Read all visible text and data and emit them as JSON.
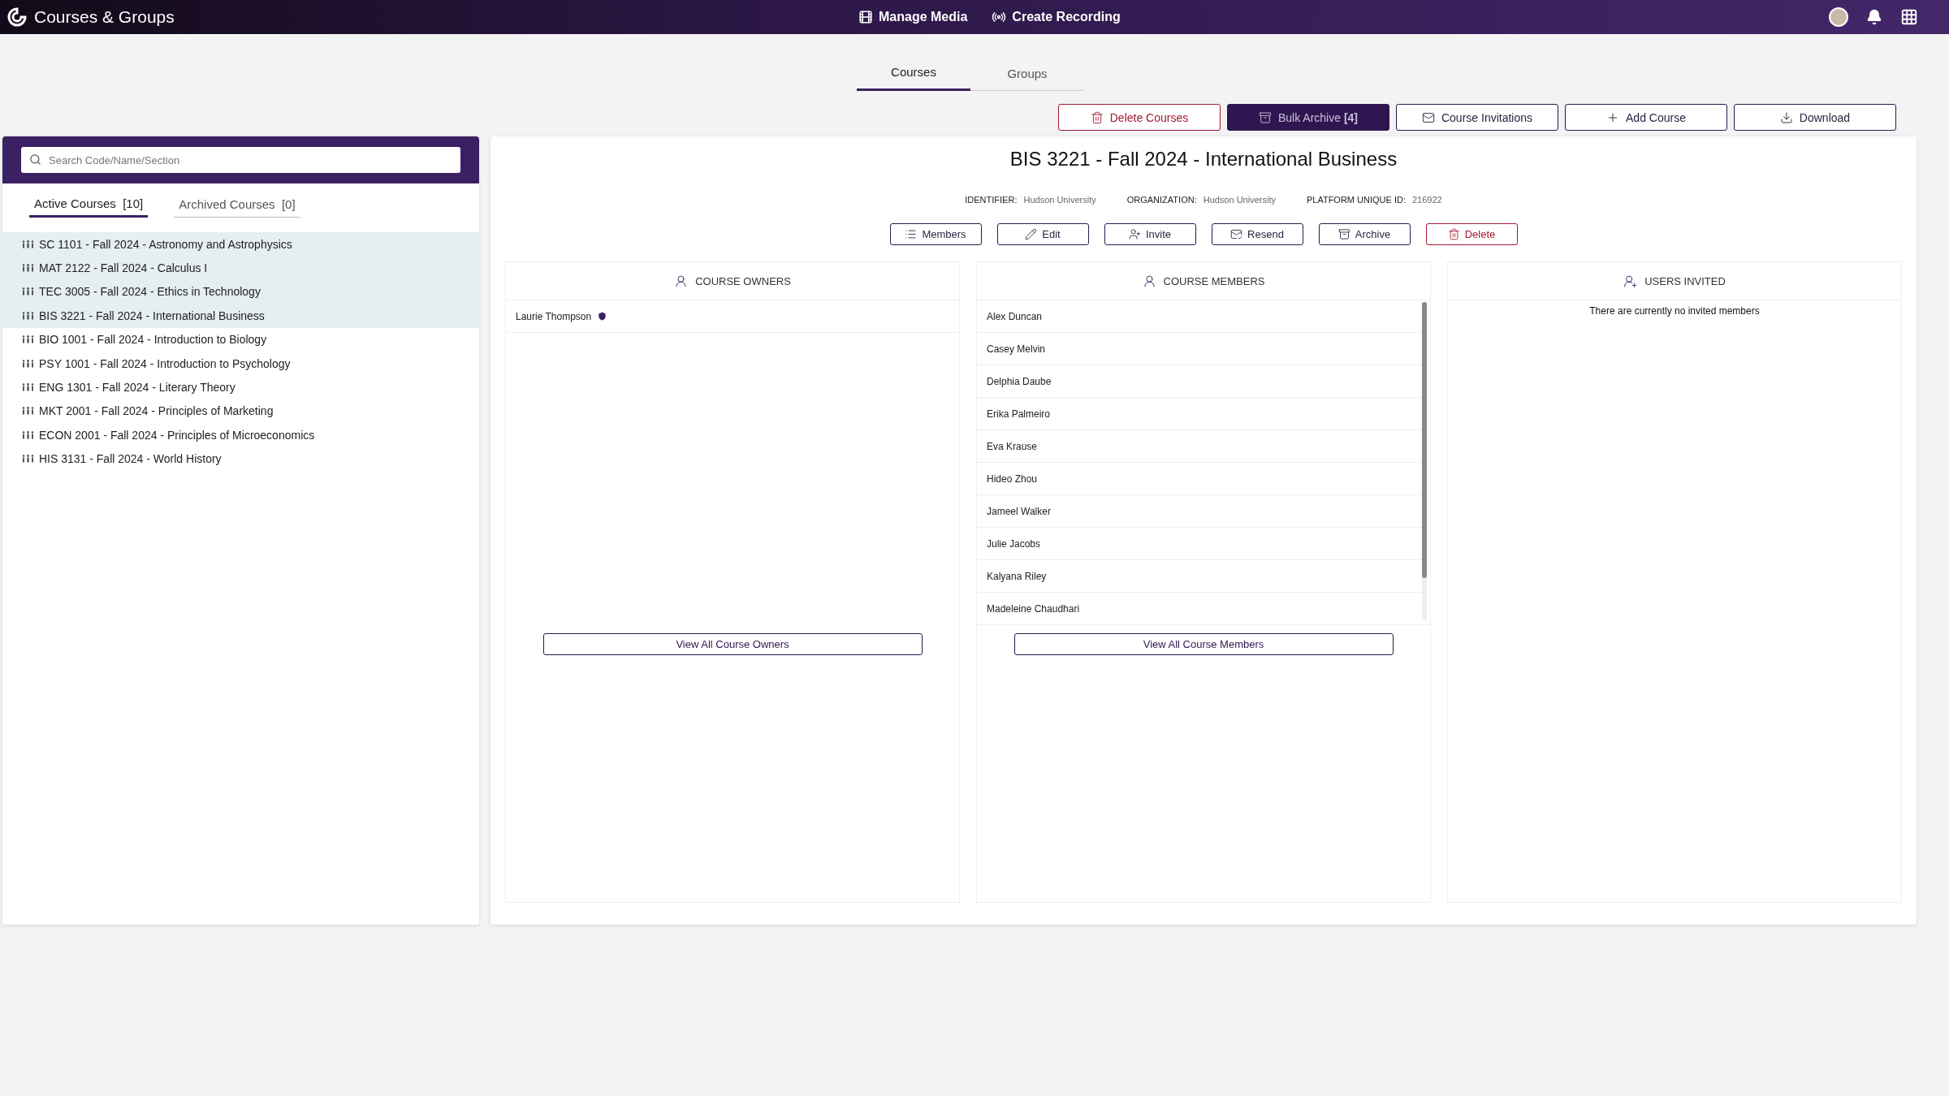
{
  "app_bar": {
    "title": "Courses & Groups",
    "actions": [
      {
        "label": "Manage Media",
        "kind": "media"
      },
      {
        "label": "Create Recording",
        "kind": "recording"
      }
    ]
  },
  "tabs": [
    {
      "label": "Courses",
      "selected": true
    },
    {
      "label": "Groups",
      "selected": false
    }
  ],
  "toolbar": [
    {
      "label": "Delete Courses",
      "kind": "delete"
    },
    {
      "label": "Bulk Archive **[4]**",
      "kind": "archive"
    },
    {
      "label": "Course Invitations",
      "kind": "invite"
    },
    {
      "label": "Add Course",
      "kind": "add"
    },
    {
      "label": "Download",
      "kind": "download"
    }
  ],
  "sidebar": {
    "search": {
      "placeholder": "Search Code/Name/Section"
    },
    "tabs": [
      {
        "label": "Active Courses  [10]",
        "selected": true
      },
      {
        "label": "Archived Courses  [0]",
        "selected": false
      }
    ],
    "courses": [
      {
        "label": "SC 1101 - Fall 2024 - Astronomy and Astrophysics",
        "selected": true
      },
      {
        "label": "MAT 2122 - Fall 2024 - Calculus I",
        "selected": true
      },
      {
        "label": "TEC 3005 - Fall 2024 - Ethics in Technology",
        "selected": true
      },
      {
        "label": "BIS 3221 - Fall 2024 - International Business",
        "selected": true
      },
      {
        "label": "BIO 1001 - Fall 2024 - Introduction to Biology",
        "selected": false
      },
      {
        "label": "PSY 1001 - Fall 2024 - Introduction to Psychology",
        "selected": false
      },
      {
        "label": "ENG 1301 - Fall 2024 - Literary Theory",
        "selected": false
      },
      {
        "label": "MKT 2001 - Fall 2024 - Principles of Marketing",
        "selected": false
      },
      {
        "label": "ECON 2001 - Fall 2024 - Principles of Microeconomics",
        "selected": false
      },
      {
        "label": "HIS 3131 - Fall 2024 - World History",
        "selected": false
      }
    ]
  },
  "course": {
    "title": "BIS 3221 - Fall 2024 - International Business",
    "meta": [
      {
        "label": "IDENTIFIER:",
        "value": "Hudson University"
      },
      {
        "label": "ORGANIZATION:",
        "value": "Hudson University"
      },
      {
        "label": "PLATFORM UNIQUE ID:",
        "value": "216922"
      }
    ],
    "actions": [
      {
        "label": "Members",
        "kind": "members"
      },
      {
        "label": "Edit",
        "kind": "edit"
      },
      {
        "label": "Invite",
        "kind": "invite"
      },
      {
        "label": "Resend",
        "kind": "resend"
      },
      {
        "label": "Archive",
        "kind": "archive"
      },
      {
        "label": "Delete",
        "kind": "delete"
      }
    ],
    "panels": [
      {
        "kind": "owners",
        "title": "COURSE OWNERS",
        "people": [
          {
            "name": "Laurie Thompson",
            "badge": true
          }
        ],
        "button": "View All Course Owners"
      },
      {
        "kind": "members",
        "title": "COURSE MEMBERS",
        "people": [
          {
            "name": "Alex Duncan",
            "badge": false
          },
          {
            "name": "Casey Melvin",
            "badge": false
          },
          {
            "name": "Delphia Daube",
            "badge": false
          },
          {
            "name": "Erika Palmeiro",
            "badge": false
          },
          {
            "name": "Eva Krause",
            "badge": false
          },
          {
            "name": "Hideo Zhou",
            "badge": false
          },
          {
            "name": "Jameel Walker",
            "badge": false
          },
          {
            "name": "Julie Jacobs",
            "badge": false
          },
          {
            "name": "Kalyana Riley",
            "badge": false
          },
          {
            "name": "Madeleine Chaudhari",
            "badge": false
          }
        ],
        "button": "View All Course Members"
      },
      {
        "kind": "invited",
        "title": "USERS INVITED",
        "empty": "There are currently no invited members"
      }
    ]
  }
}
